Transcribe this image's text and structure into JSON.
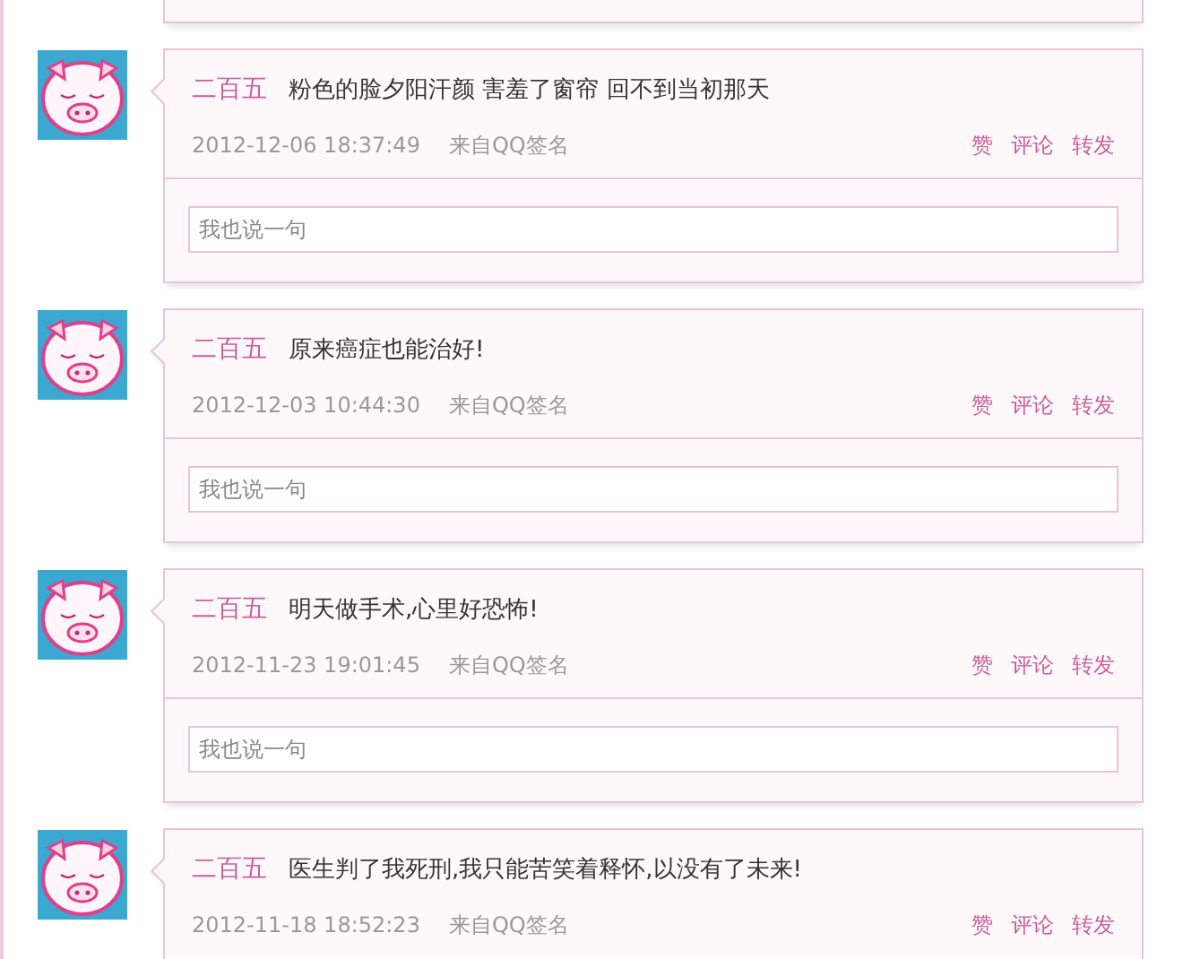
{
  "posts": [
    {
      "author": "二百五",
      "text": "粉色的脸夕阳汗颜 害羞了窗帘 回不到当初那天",
      "time": "2012-12-06 18:37:49",
      "source": "来自QQ签名",
      "actions": [
        "赞",
        "评论",
        "转发"
      ],
      "reply": {
        "placeholder": "我也说一句"
      }
    },
    {
      "author": "二百五",
      "text": "原来癌症也能治好!",
      "time": "2012-12-03 10:44:30",
      "source": "来自QQ签名",
      "actions": [
        "赞",
        "评论",
        "转发"
      ],
      "reply": {
        "placeholder": "我也说一句"
      }
    },
    {
      "author": "二百五",
      "text": "明天做手术,心里好恐怖!",
      "time": "2012-11-23 19:01:45",
      "source": "来自QQ签名",
      "actions": [
        "赞",
        "评论",
        "转发"
      ],
      "reply": {
        "placeholder": "我也说一句"
      }
    },
    {
      "author": "二百五",
      "text": "医生判了我死刑,我只能苦笑着释怀,以没有了未来!",
      "time": "2012-11-18 18:52:23",
      "source": "来自QQ签名",
      "actions": [
        "赞",
        "评论",
        "转发"
      ]
    }
  ]
}
